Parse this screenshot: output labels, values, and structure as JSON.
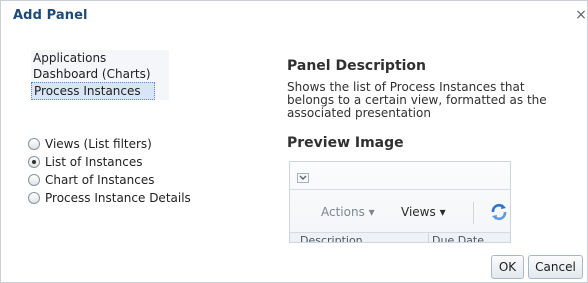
{
  "dialog": {
    "title": "Add Panel",
    "close_label": "×"
  },
  "panel_types": [
    {
      "label": "Applications",
      "selected": false
    },
    {
      "label": "Dashboard (Charts)",
      "selected": false
    },
    {
      "label": "Process Instances",
      "selected": true
    }
  ],
  "view_options": [
    {
      "label": "Views (List filters)",
      "checked": false
    },
    {
      "label": "List of Instances",
      "checked": true
    },
    {
      "label": "Chart of Instances",
      "checked": false
    },
    {
      "label": "Process Instance Details",
      "checked": false
    }
  ],
  "description": {
    "heading": "Panel Description",
    "text": "Shows the list of Process Instances that belongs to a certain view, formatted as the associated presentation"
  },
  "preview": {
    "heading": "Preview Image",
    "collapse_icon": "chevron-down-icon",
    "actions_label": "Actions",
    "actions_arrow": "▾",
    "views_label": "Views",
    "views_arrow": "▾",
    "refresh_icon": "refresh-icon",
    "columns": [
      "Description",
      "Due Date"
    ]
  },
  "buttons": {
    "ok": "OK",
    "cancel": "Cancel"
  },
  "colors": {
    "title": "#1d4a78",
    "selection_background": "#d7e5f7",
    "refresh_blue": "#2f73c8"
  }
}
